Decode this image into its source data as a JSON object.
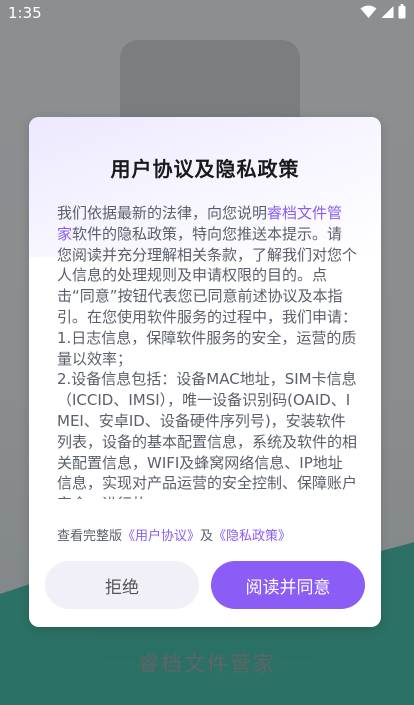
{
  "status_bar": {
    "time": "1:35"
  },
  "splash": {
    "app_name": "睿档文件管家"
  },
  "dialog": {
    "title": "用户协议及隐私政策",
    "body_pre": "我们依据最新的法律，向您说明",
    "body_app_name": "睿档文件管家",
    "body_main": "软件的隐私政策，特向您推送本提示。请您阅读并充分理解相关条款，了解我们对您个人信息的处理规则及申请权限的目的。点击“同意”按钮代表您已同意前述协议及本指引。在您使用软件服务的过程中，我们申请：",
    "body_item1": "1.日志信息，保障软件服务的安全，运营的质量以效率；",
    "body_item2": "2.设备信息包括：设备MAC地址，SIM卡信息（ICCID、IMSI），唯一设备识别码(OAID、IMEI、安卓ID、设备硬件序列号)，安装软件列表，设备的基本配置信息，系统及软件的相关配置信息，WIFI及蜂窝网络信息、IP地址信息，实现对产品运营的安全控制、保障账户安全、进行故",
    "links_prefix": "查看完整版",
    "link_user_agreement": "《用户协议》",
    "links_and": "及",
    "link_privacy_policy": "《隐私政策》",
    "reject_label": "拒绝",
    "agree_label": "阅读并同意"
  },
  "colors": {
    "accent": "#8b5cf6",
    "reject_bg": "#f1f0f8"
  }
}
